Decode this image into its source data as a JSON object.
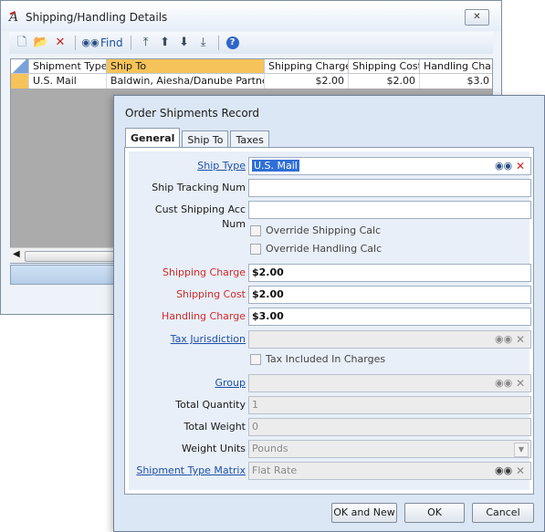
{
  "back_window": {
    "title": "Shipping/Handling Details",
    "close_glyph": "✕",
    "toolbar": {
      "find_label": "Find"
    },
    "grid": {
      "columns": [
        "Shipment Type",
        "Ship To",
        "Shipping Charge",
        "Shipping Cost",
        "Handling Charg"
      ],
      "rows": [
        [
          "U.S. Mail",
          "Baldwin, Aiesha/Danube Partners",
          "$2.00",
          "$2.00",
          "$3.0"
        ]
      ]
    }
  },
  "dialog": {
    "title": "Order Shipments Record",
    "tabs": [
      {
        "label": "General",
        "active": true
      },
      {
        "label": "Ship To",
        "active": false
      },
      {
        "label": "Taxes",
        "active": false
      }
    ],
    "fields": {
      "ship_type": {
        "label": "Ship Type",
        "value": "U.S. Mail"
      },
      "ship_tracking": {
        "label": "Ship Tracking Num",
        "value": ""
      },
      "cust_shipping_acc": {
        "label": "Cust Shipping Acc Num",
        "value": ""
      },
      "override_shipping": {
        "label": "Override Shipping Calc",
        "checked": false
      },
      "override_handling": {
        "label": "Override Handling Calc",
        "checked": false
      },
      "shipping_charge": {
        "label": "Shipping Charge",
        "value": "$2.00"
      },
      "shipping_cost": {
        "label": "Shipping Cost",
        "value": "$2.00"
      },
      "handling_charge": {
        "label": "Handling Charge",
        "value": "$3.00"
      },
      "tax_jurisdiction": {
        "label": "Tax Jurisdiction",
        "value": ""
      },
      "tax_included": {
        "label": "Tax Included In Charges",
        "checked": false
      },
      "group": {
        "label": "Group",
        "value": ""
      },
      "total_quantity": {
        "label": "Total Quantity",
        "value": "1"
      },
      "total_weight": {
        "label": "Total Weight",
        "value": "0"
      },
      "weight_units": {
        "label": "Weight Units",
        "value": "Pounds"
      },
      "shipment_type_matrix": {
        "label": "Shipment Type Matrix",
        "value": "Flat Rate"
      }
    },
    "buttons": {
      "ok_and_new": "OK and New",
      "ok": "OK",
      "cancel": "Cancel"
    }
  }
}
